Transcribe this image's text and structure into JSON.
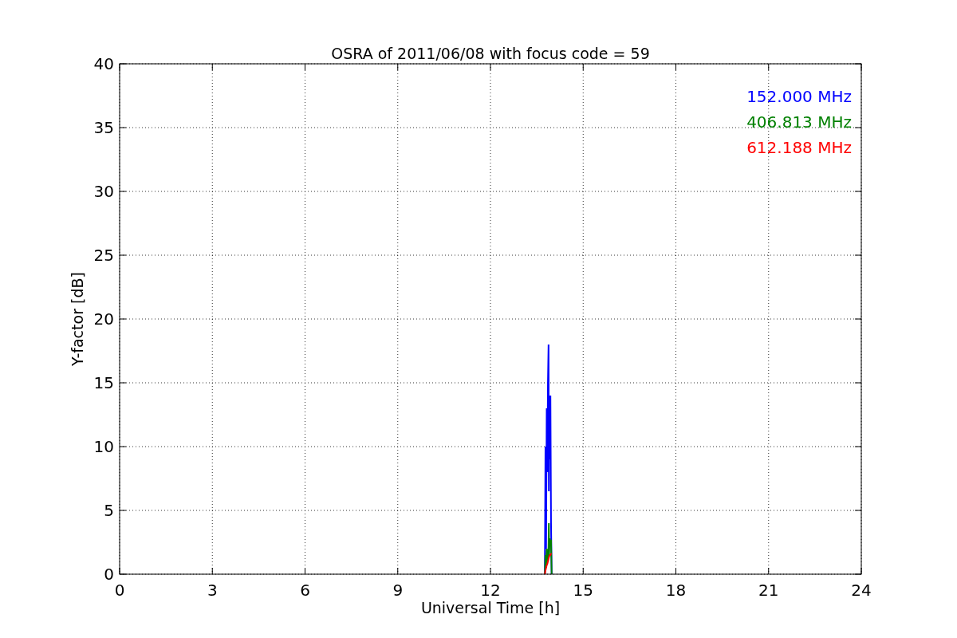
{
  "chart_data": {
    "type": "line",
    "title": "OSRA of 2011/06/08 with focus code = 59",
    "xlabel": "Universal Time [h]",
    "ylabel": "Y-factor [dB]",
    "x": [
      13.76,
      13.78,
      13.8,
      13.82,
      13.84,
      13.86,
      13.87,
      13.88,
      13.89,
      13.9,
      13.92,
      13.94,
      13.96,
      13.98
    ],
    "series": [
      {
        "name": "152.000 MHz",
        "color": "#0000ff",
        "values": [
          0,
          10,
          2,
          13,
          8,
          15,
          16.5,
          18,
          6.5,
          14,
          9,
          14,
          4,
          0
        ]
      },
      {
        "name": "406.813 MHz",
        "color": "#008000",
        "values": [
          0,
          1.5,
          0.5,
          2,
          1,
          1.8,
          1.2,
          2.5,
          4,
          1.5,
          2.8,
          2.2,
          2.7,
          0
        ]
      },
      {
        "name": "612.188 MHz",
        "color": "#ff0000",
        "values": [
          0,
          0.3,
          0.5,
          0.7,
          0.8,
          1,
          1.1,
          1.2,
          1.3,
          1.4,
          1.5,
          1.5,
          1.6,
          1.6
        ]
      }
    ],
    "xlim": [
      0,
      24
    ],
    "ylim": [
      0,
      40
    ],
    "xticks": [
      0,
      3,
      6,
      9,
      12,
      15,
      18,
      21,
      24
    ],
    "yticks": [
      0,
      5,
      10,
      15,
      20,
      25,
      30,
      35,
      40
    ],
    "grid": true
  }
}
